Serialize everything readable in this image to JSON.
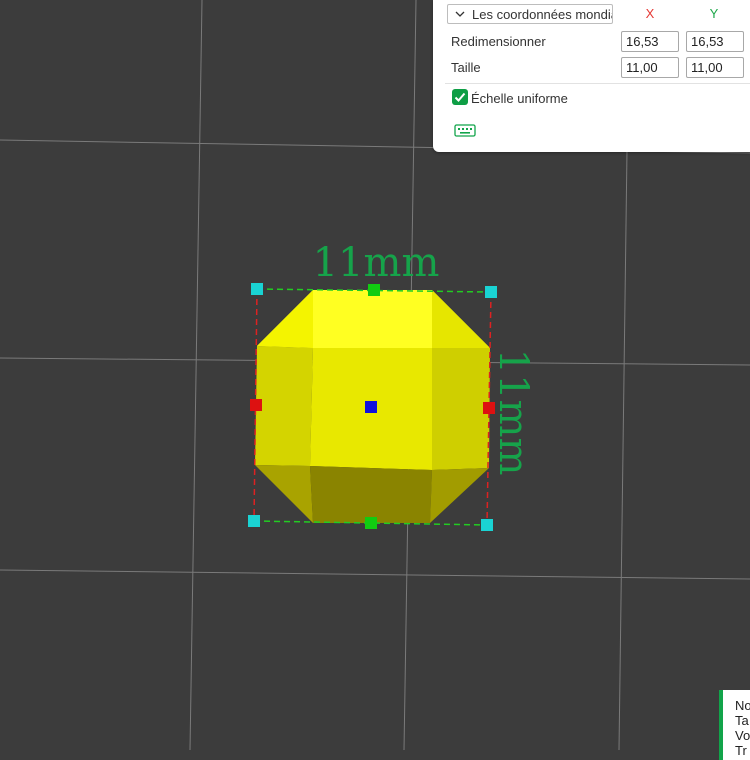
{
  "scale_panel": {
    "coordinate_mode": "Les coordonnées mondiales",
    "axis_x_label": "X",
    "axis_y_label": "Y",
    "axis_x_color": "#e53935",
    "axis_y_color": "#1ea84a",
    "rescale_label": "Redimensionner",
    "rescale_x": "16,53",
    "rescale_y": "16,53",
    "size_label": "Taille",
    "size_x": "11,00",
    "size_y": "11,00",
    "uniform_scale_label": "Échelle uniforme",
    "uniform_scale_checked": true,
    "keyboard_icon": "keyboard-icon"
  },
  "viewport": {
    "dimension_width": "11mm",
    "dimension_height": "11mm",
    "object_color": "#f2f000",
    "dimension_color": "#16a34a"
  },
  "status_box": {
    "line1": "No",
    "line2": "Ta",
    "line3": "Vo",
    "line4": "Tr"
  }
}
